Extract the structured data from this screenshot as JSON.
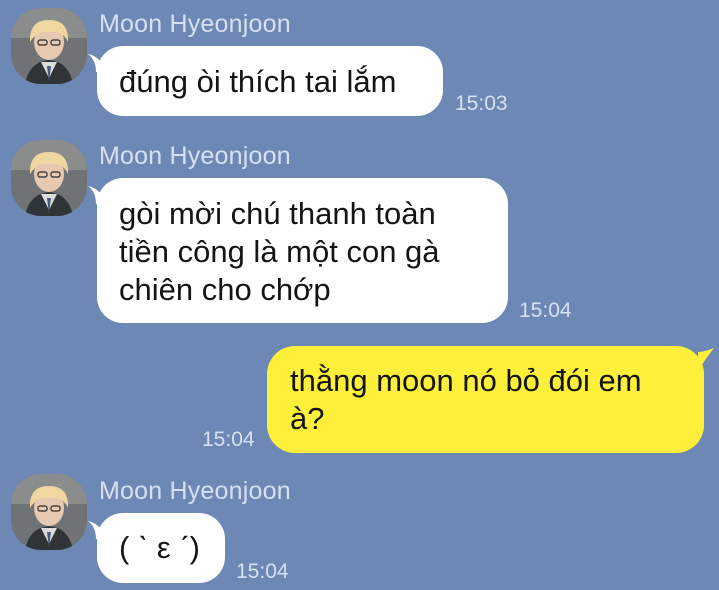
{
  "chat": {
    "messages": [
      {
        "direction": "incoming",
        "sender": "Moon Hyeonjoon",
        "text": "đúng òi thích tai lắm",
        "time": "15:03"
      },
      {
        "direction": "incoming",
        "sender": "Moon Hyeonjoon",
        "text": "gòi mời chú thanh toàn\ntiền công là một con gà\nchiên cho chớp",
        "time": "15:04"
      },
      {
        "direction": "outgoing",
        "text": "thằng moon nó bỏ đói em\nà?",
        "time": "15:04"
      },
      {
        "direction": "incoming",
        "sender": "Moon Hyeonjoon",
        "text": "( ˋ ε ˊ)",
        "time": "15:04"
      }
    ]
  },
  "colors": {
    "background": "#6e88b6",
    "incoming_bubble": "#ffffff",
    "outgoing_bubble": "#fef03a",
    "meta_text": "#d6e1f3"
  },
  "icons": {
    "avatar": "profile-photo-avatar"
  }
}
